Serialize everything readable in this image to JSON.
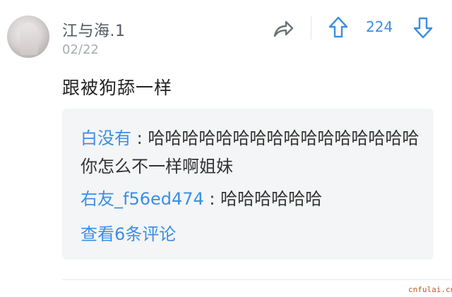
{
  "comment": {
    "username": "江与海.1",
    "date": "02/22",
    "text": "跟被狗舔一样",
    "vote_count": "224"
  },
  "replies": [
    {
      "user": "白没有",
      "separator": " : ",
      "text": "哈哈哈哈哈哈哈哈哈哈哈哈哈哈哈哈你怎么不一样啊姐妹"
    },
    {
      "user": "右友_f56ed474",
      "separator": " : ",
      "text": "哈哈哈哈哈哈"
    }
  ],
  "view_more": "查看6条评论",
  "watermark": "cnfulai.cn",
  "icons": {
    "share": "share-arrow-icon",
    "upvote": "arrow-up-icon",
    "downvote": "arrow-down-icon"
  },
  "colors": {
    "accent": "#3a8ee6",
    "reply_background": "#f4f5f7",
    "username": "#555a60",
    "date": "#a7abb1",
    "watermark": "#c05a2a"
  }
}
